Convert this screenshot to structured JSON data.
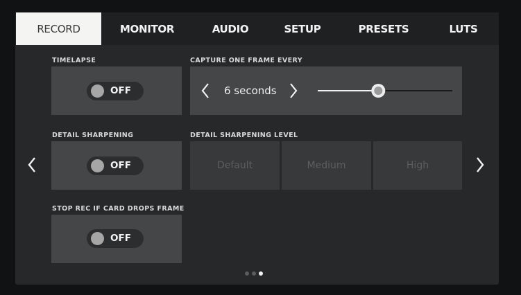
{
  "tabs": [
    {
      "label": "RECORD",
      "active": true
    },
    {
      "label": "MONITOR",
      "active": false
    },
    {
      "label": "AUDIO",
      "active": false
    },
    {
      "label": "SETUP",
      "active": false
    },
    {
      "label": "PRESETS",
      "active": false
    },
    {
      "label": "LUTS",
      "active": false
    }
  ],
  "timelapse": {
    "label": "TIMELAPSE",
    "toggle": "OFF"
  },
  "capture": {
    "label": "CAPTURE ONE FRAME EVERY",
    "value": "6 seconds",
    "slider_fraction": 0.45
  },
  "sharpening": {
    "label": "DETAIL SHARPENING",
    "toggle": "OFF"
  },
  "sharpening_level": {
    "label": "DETAIL SHARPENING LEVEL",
    "options": [
      "Default",
      "Medium",
      "High"
    ]
  },
  "stop_rec": {
    "label": "STOP REC IF CARD DROPS FRAME",
    "toggle": "OFF"
  },
  "pager": {
    "pages": 3,
    "current": 3
  },
  "icons": {
    "prev_page": "chevron-left-icon",
    "next_page": "chevron-right-icon",
    "value_prev": "chevron-left-icon",
    "value_next": "chevron-right-icon"
  },
  "colors": {
    "active_tab_bg": "#f4f4f2",
    "tile_bg": "#444648",
    "toggle_knob_off": "#a6a6a6"
  }
}
